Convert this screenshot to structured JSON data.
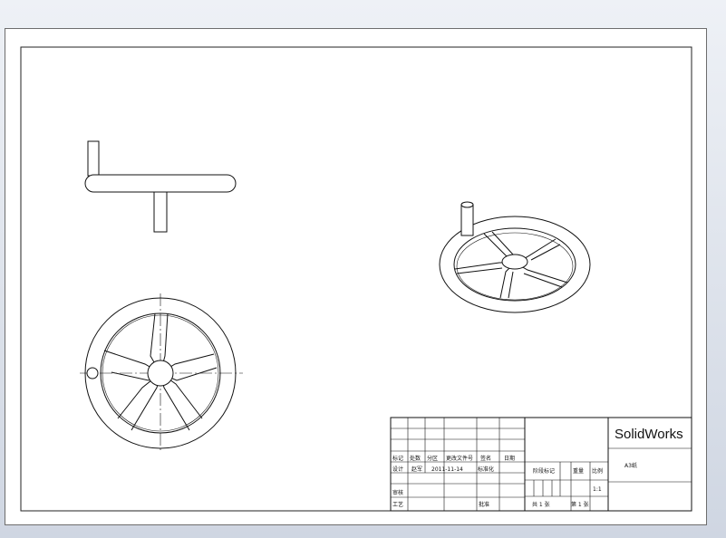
{
  "drawing": {
    "views": {
      "front_view": "front-view",
      "top_view": "top-view",
      "isometric_view": "isometric-view"
    }
  },
  "title_block": {
    "brand": "SolidWorks",
    "sheet_size": "A3纸",
    "headers": {
      "mark": "标记",
      "count": "处数",
      "zone": "分区",
      "change_doc": "更改文件号",
      "signature": "签名",
      "date": "日期"
    },
    "rows": {
      "design_label": "设计",
      "designer": "赵军",
      "design_date": "2011-11-14",
      "standardization_label": "标准化",
      "review_label": "审核",
      "process_label": "工艺",
      "approve_label": "批准"
    },
    "stage_mark_label": "阶段标记",
    "weight_label": "重量",
    "scale_label": "比例",
    "scale_value": "1:1",
    "total_sheets": "共 1 张",
    "sheet_no": "第 1 张"
  }
}
